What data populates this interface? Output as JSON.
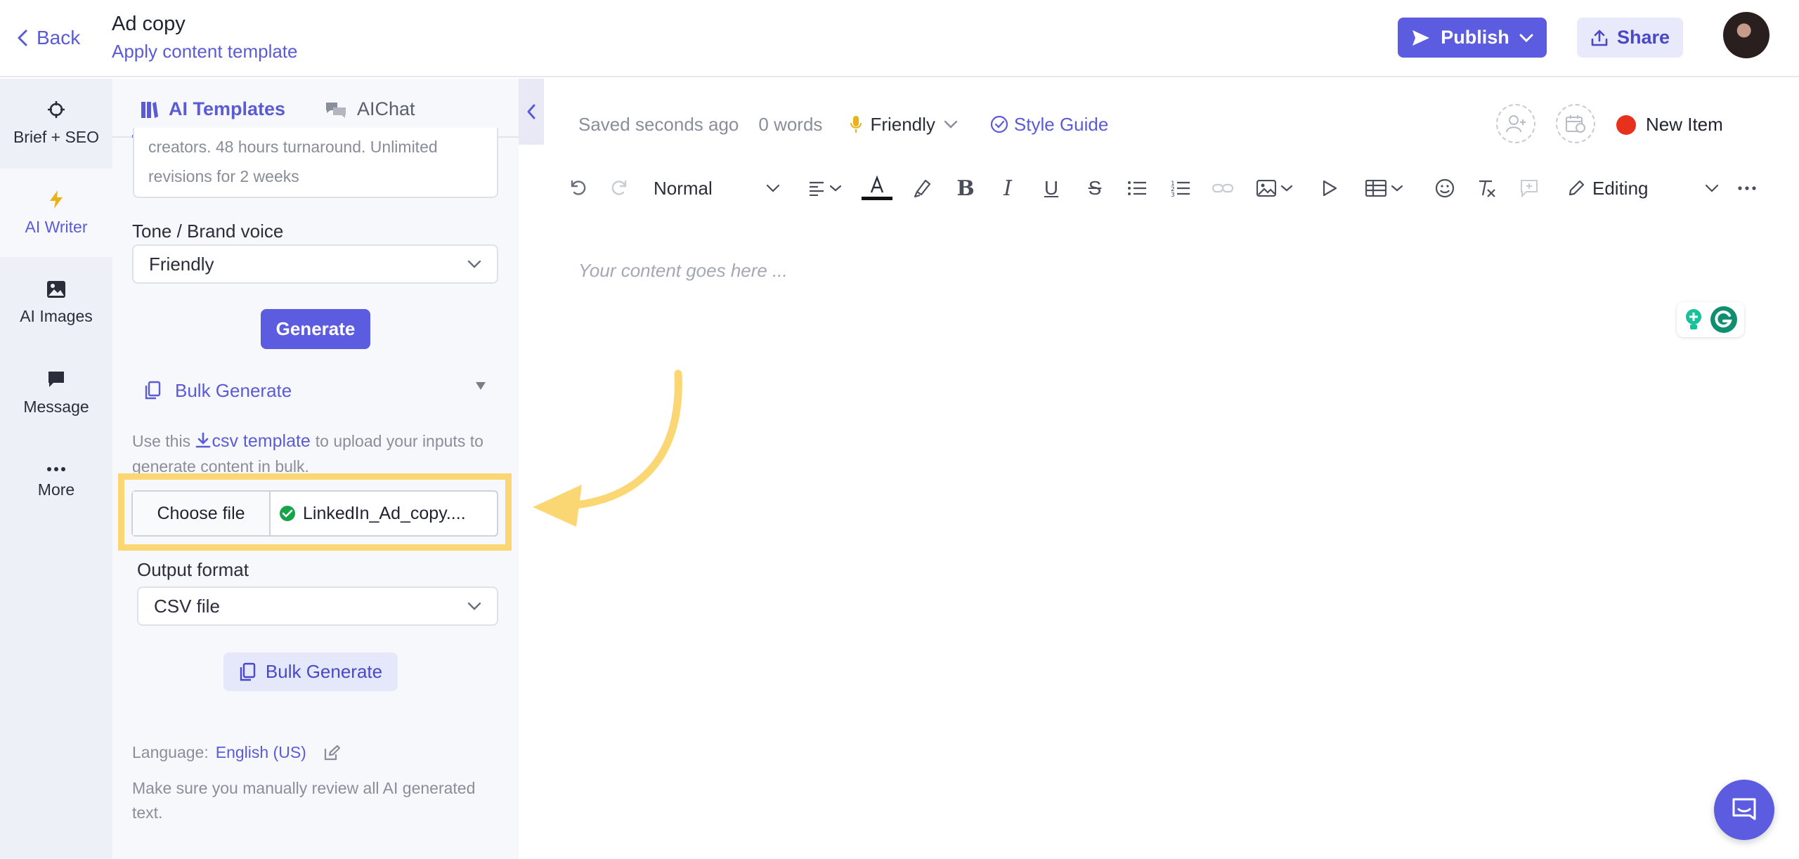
{
  "header": {
    "back_label": "Back",
    "title": "Ad copy",
    "subtitle": "Apply content template",
    "publish_label": "Publish",
    "share_label": "Share"
  },
  "rail": {
    "items": [
      {
        "label": "Brief + SEO",
        "icon": "crosshair-icon"
      },
      {
        "label": "AI Writer",
        "icon": "lightning-icon"
      },
      {
        "label": "AI Images",
        "icon": "image-icon"
      },
      {
        "label": "Message",
        "icon": "chat-bubble-icon"
      },
      {
        "label": "More",
        "icon": "ellipsis-icon"
      }
    ],
    "active_index": 1
  },
  "panel": {
    "tabs": [
      {
        "label": "AI Templates"
      },
      {
        "label": "AIChat"
      }
    ],
    "description_value": "creators. 48 hours turnaround. Unlimited revisions for 2 weeks",
    "tone_label": "Tone / Brand voice",
    "tone_value": "Friendly",
    "generate_label": "Generate",
    "bulk_generate_header": "Bulk Generate",
    "help_prefix": "Use this",
    "help_link": "csv template",
    "help_suffix": "to upload your inputs to generate content in bulk.",
    "choose_file_label": "Choose file",
    "file_name": "LinkedIn_Ad_copy....",
    "output_format_label": "Output format",
    "output_format_value": "CSV file",
    "bulk_generate_button": "Bulk Generate",
    "language_label": "Language:",
    "language_value": "English (US)",
    "review_note": "Make sure you manually review all AI generated text."
  },
  "editor": {
    "saved_status": "Saved seconds ago",
    "word_count": "0 words",
    "tone": "Friendly",
    "style_guide": "Style Guide",
    "status_label": "New Item",
    "status_color": "#e8311c",
    "toolbar": {
      "block_style": "Normal",
      "mode": "Editing"
    },
    "placeholder": "Your content goes here ..."
  },
  "colors": {
    "accent": "#5c5ce0",
    "highlight": "#fbd774",
    "rail_bg": "#eef0f7",
    "panel_bg": "#f7f8fc"
  }
}
